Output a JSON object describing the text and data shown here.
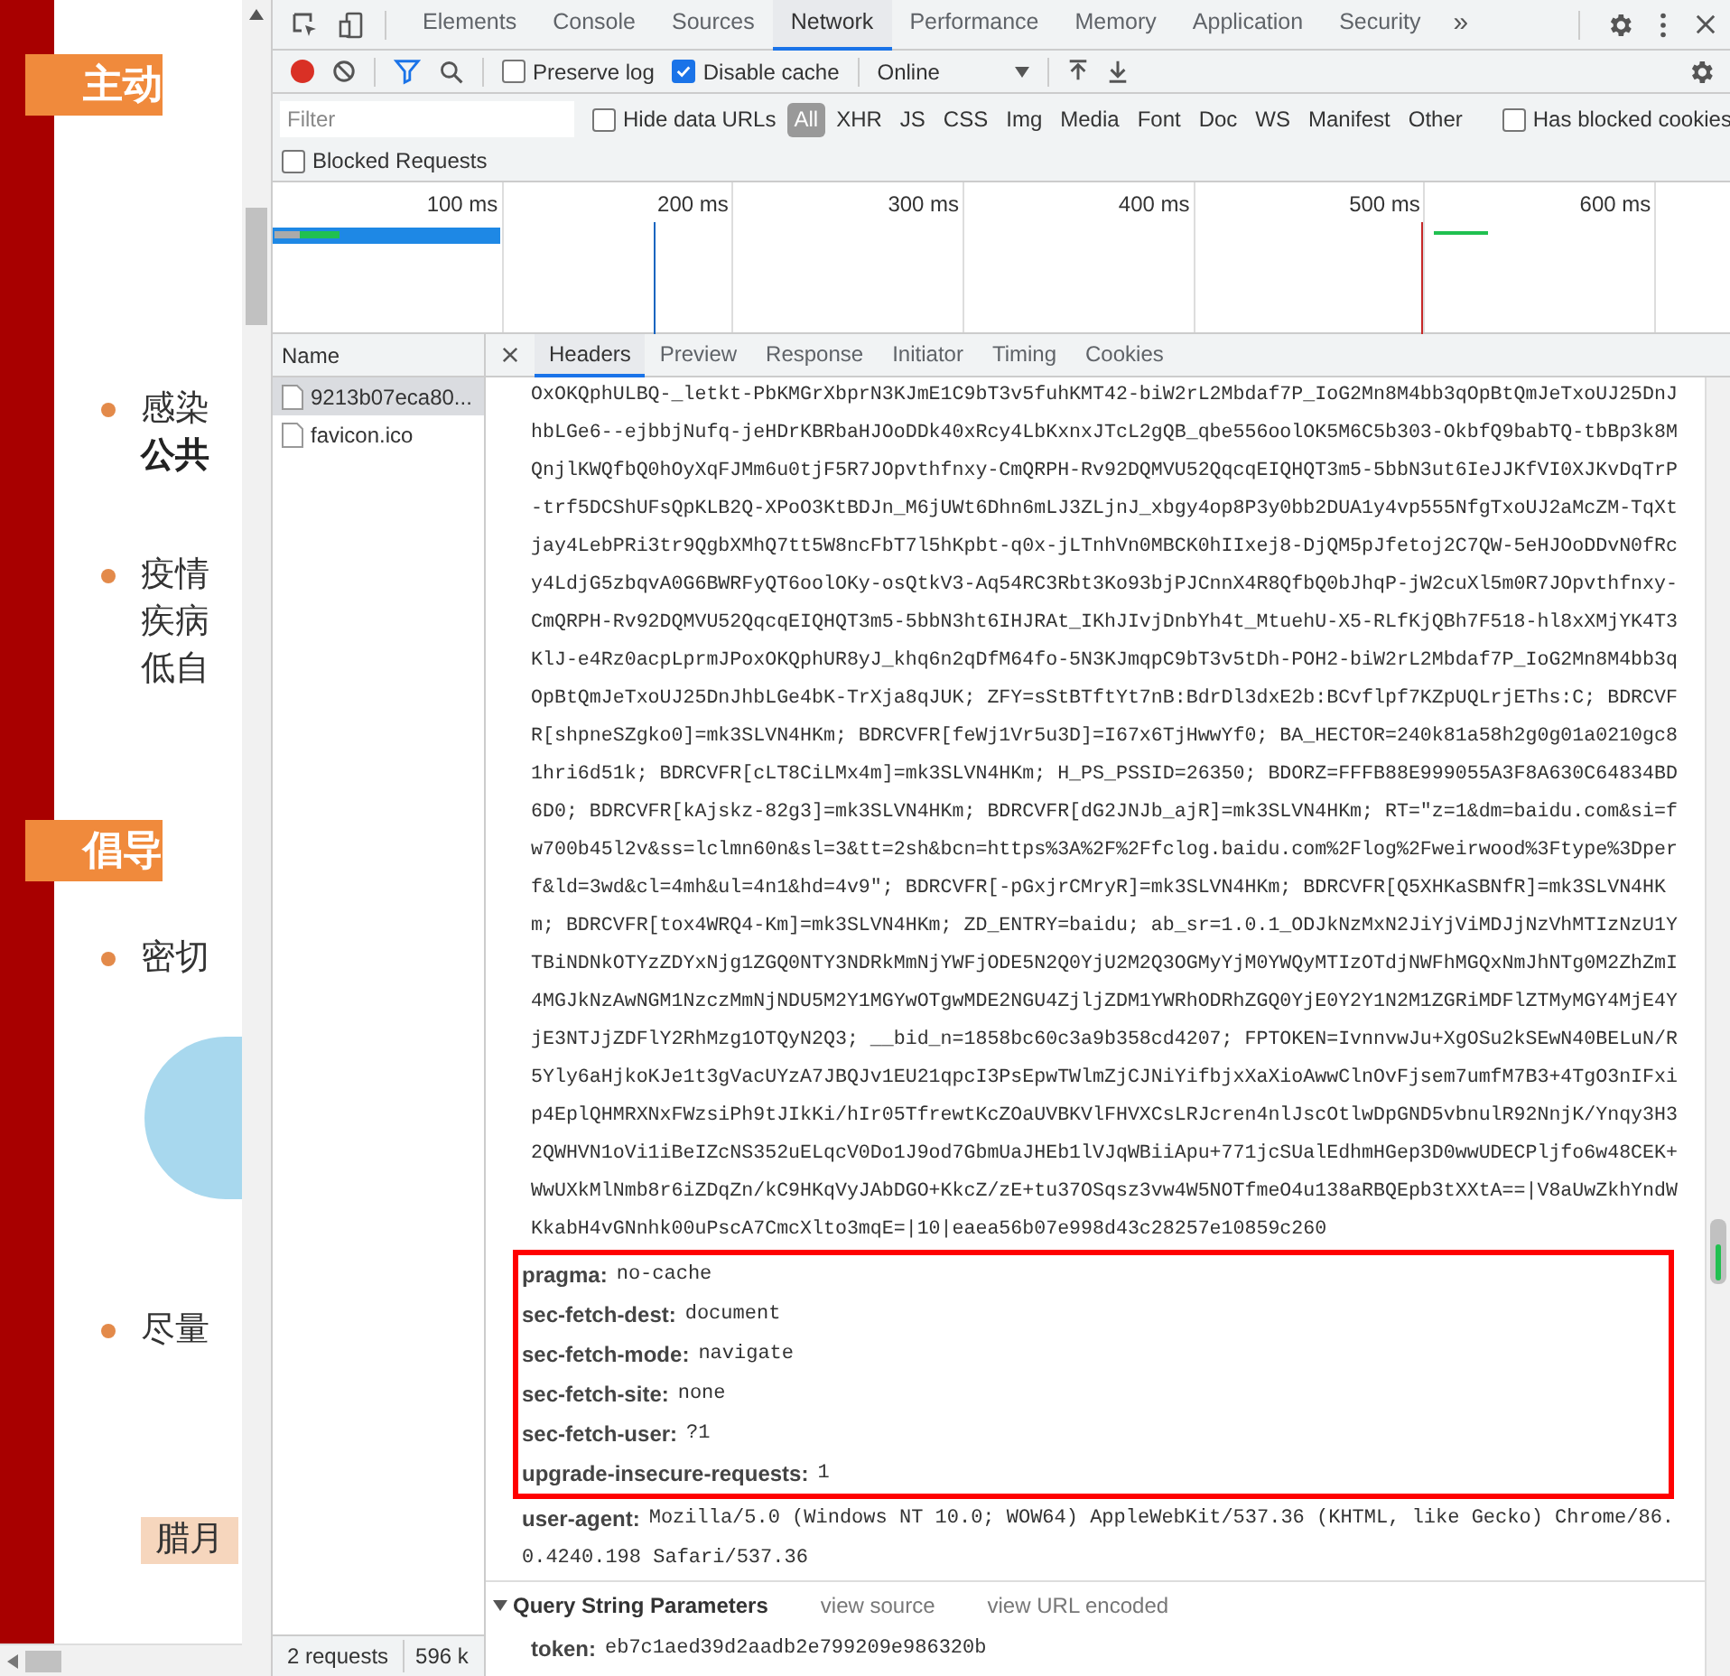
{
  "page": {
    "texts": [
      {
        "kind": "banner",
        "text": "主动"
      },
      {
        "kind": "bullet",
        "text": "感染"
      },
      {
        "kind": "bold",
        "text": "公共"
      },
      {
        "kind": "bullet",
        "text": "疫情"
      },
      {
        "kind": "plain",
        "text": "疾病"
      },
      {
        "kind": "plain",
        "text": "低自"
      },
      {
        "kind": "banner",
        "text": "倡导"
      },
      {
        "kind": "bullet",
        "text": "密切"
      },
      {
        "kind": "image"
      },
      {
        "kind": "bullet",
        "text": "尽量"
      },
      {
        "kind": "label",
        "text": "腊月"
      }
    ]
  },
  "panel_tabs": [
    {
      "label": "Elements",
      "selected": false
    },
    {
      "label": "Console",
      "selected": false
    },
    {
      "label": "Sources",
      "selected": false
    },
    {
      "label": "Network",
      "selected": true
    },
    {
      "label": "Performance",
      "selected": false
    },
    {
      "label": "Memory",
      "selected": false
    },
    {
      "label": "Application",
      "selected": false
    },
    {
      "label": "Security",
      "selected": false
    }
  ],
  "more_tabs": "»",
  "toolbar": {
    "preserve_log": {
      "label": "Preserve log",
      "checked": false
    },
    "disable_cache": {
      "label": "Disable cache",
      "checked": true
    },
    "throttling": "Online"
  },
  "filter": {
    "placeholder": "Filter",
    "hide_data_urls": {
      "label": "Hide data URLs",
      "checked": false
    },
    "types": [
      {
        "label": "All",
        "selected": true
      },
      {
        "label": "XHR",
        "selected": false
      },
      {
        "label": "JS",
        "selected": false
      },
      {
        "label": "CSS",
        "selected": false
      },
      {
        "label": "Img",
        "selected": false
      },
      {
        "label": "Media",
        "selected": false
      },
      {
        "label": "Font",
        "selected": false
      },
      {
        "label": "Doc",
        "selected": false
      },
      {
        "label": "WS",
        "selected": false
      },
      {
        "label": "Manifest",
        "selected": false
      },
      {
        "label": "Other",
        "selected": false
      }
    ],
    "has_blocked_cookies": {
      "label": "Has blocked cookies",
      "checked": false
    },
    "blocked_requests": {
      "label": "Blocked Requests",
      "checked": false
    }
  },
  "timeline": {
    "ticks": [
      "100 ms",
      "200 ms",
      "300 ms",
      "400 ms",
      "500 ms",
      "600 ms"
    ]
  },
  "requests": {
    "column": "Name",
    "items": [
      {
        "name": "9213b07eca80...",
        "selected": true
      },
      {
        "name": "favicon.ico",
        "selected": false
      }
    ],
    "status": [
      "2 requests",
      "596 k"
    ]
  },
  "detail_tabs": [
    {
      "label": "Headers",
      "selected": true
    },
    {
      "label": "Preview",
      "selected": false
    },
    {
      "label": "Response",
      "selected": false
    },
    {
      "label": "Initiator",
      "selected": false
    },
    {
      "label": "Timing",
      "selected": false
    },
    {
      "label": "Cookies",
      "selected": false
    }
  ],
  "cookie_lines": [
    "OxOKQphULBQ-_letkt-PbKMGrXbprN3KJmE1C9bT3v5fuhKMT42-biW2rL2Mbdaf7P_IoG2Mn8M4bb3qOpBtQmJeTxoUJ25DnJ",
    "hbLGe6--ejbbjNufq-jeHDrKBRbaHJOoDDk40xRcy4LbKxnxJTcL2gQB_qbe556oolOK5M6C5b303-OkbfQ9babTQ-tbBp3k8M",
    "QnjlKWQfbQ0hOyXqFJMm6u0tjF5R7JOpvthfnxy-CmQRPH-Rv92DQMVU52QqcqEIQHQT3m5-5bbN3ut6IeJJKfVI0XJKvDqTrP",
    "-trf5DCShUFsQpKLB2Q-XPoO3KtBDJn_M6jUWt6Dhn6mLJ3ZLjnJ_xbgy4op8P3y0bb2DUA1y4vp555NfgTxoUJ2aMcZM-TqXt",
    "jay4LebPRi3tr9QgbXMhQ7tt5W8ncFbT7l5hKpbt-q0x-jLTnhVn0MBCK0hIIxej8-DjQM5pJfetoj2C7QW-5eHJOoDDvN0fRc",
    "y4LdjG5zbqvA0G6BWRFyQT6oolOKy-osQtkV3-Aq54RC3Rbt3Ko93bjPJCnnX4R8QfbQ0bJhqP-jW2cuXl5m0R7JOpvthfnxy-",
    "CmQRPH-Rv92DQMVU52QqcqEIQHQT3m5-5bbN3ht6IHJRAt_IKhJIvjDnbYh4t_MtuehU-X5-RLfKjQBh7F518-hl8xXMjYK4T3",
    "KlJ-e4Rz0acpLprmJPoxOKQphUR8yJ_khq6n2qDfM64fo-5N3KJmqpC9bT3v5tDh-POH2-biW2rL2Mbdaf7P_IoG2Mn8M4bb3q",
    "OpBtQmJeTxoUJ25DnJhbLGe4bK-TrXja8qJUK; ZFY=sStBTftYt7nB:BdrDl3dxE2b:BCvflpf7KZpUQLrjEThs:C; BDRCVF",
    "R[shpneSZgko0]=mk3SLVN4HKm; BDRCVFR[feWj1Vr5u3D]=I67x6TjHwwYf0; BA_HECTOR=240k81a58h2g0g01a0210gc8",
    "1hri6d51k; BDRCVFR[cLT8CiLMx4m]=mk3SLVN4HKm; H_PS_PSSID=26350; BDORZ=FFFB88E999055A3F8A630C64834BD",
    "6D0; BDRCVFR[kAjskz-82g3]=mk3SLVN4HKm; BDRCVFR[dG2JNJb_ajR]=mk3SLVN4HKm; RT=\"z=1&dm=baidu.com&si=f",
    "w700b45l2v&ss=lclmn60n&sl=3&tt=2sh&bcn=https%3A%2F%2Ffclog.baidu.com%2Flog%2Fweirwood%3Ftype%3Dper",
    "f&ld=3wd&cl=4mh&ul=4n1&hd=4v9\"; BDRCVFR[-pGxjrCMryR]=mk3SLVN4HKm; BDRCVFR[Q5XHKaSBNfR]=mk3SLVN4HK",
    "m; BDRCVFR[tox4WRQ4-Km]=mk3SLVN4HKm; ZD_ENTRY=baidu; ab_sr=1.0.1_ODJkNzMxN2JiYjViMDJjNzVhMTIzNzU1Y",
    "TBiNDNkOTYzZDYxNjg1ZGQ0NTY3NDRkMmNjYWFjODE5N2Q0YjU2M2Q3OGMyYjM0YWQyMTIzOTdjNWFhMGQxNmJhNTg0M2ZhZmI",
    "4MGJkNzAwNGM1NzczMmNjNDU5M2Y1MGYwOTgwMDE2NGU4ZjljZDM1YWRhODRhZGQ0YjE0Y2Y1N2M1ZGRiMDFlZTMyMGY4MjE4Y",
    "jE3NTJjZDFlY2RhMzg1OTQyN2Q3; __bid_n=1858bc60c3a9b358cd4207; FPTOKEN=IvnnvwJu+XgOSu2kSEwN40BELuN/R",
    "5Yly6aHjkoKJe1t3gVacUYzA7JBQJv1EU21qpcI3PsEpwTWlmZjCJNiYifbjxXaXioAwwClnOvFjsem7umfM7B3+4TgO3nIFxi",
    "p4EplQHMRXNxFWzsiPh9tJIkKi/hIr05TfrewtKcZOaUVBKVlFHVXCsLRJcren4nlJscOtlwDpGND5vbnulR92NnjK/Ynqy3H3",
    "2QWHVN1oVi1iBeIZcNS352uELqcV0Do1J9od7GbmUaJHEb1lVJqWBiiApu+771jcSUalEdhmHGep3D0wwUDECPljfo6w48CEK+",
    "WwUXkMlNmb8r6iZDqZn/kC9HKqVyJAbDGO+KkcZ/zE+tu37OSqsz3vw4W5NOTfmeO4u138aRBQEpb3tXXtA==|V8aUwZkhYndW",
    "KkabH4vGNnhk00uPscA7CmcXlto3mqE=|10|eaea56b07e998d43c28257e10859c260"
  ],
  "highlighted_headers": [
    {
      "name": "pragma:",
      "value": "no-cache"
    },
    {
      "name": "sec-fetch-dest:",
      "value": "document"
    },
    {
      "name": "sec-fetch-mode:",
      "value": "navigate"
    },
    {
      "name": "sec-fetch-site:",
      "value": "none"
    },
    {
      "name": "sec-fetch-user:",
      "value": "?1"
    },
    {
      "name": "upgrade-insecure-requests:",
      "value": "1"
    }
  ],
  "other_headers": [
    {
      "name": "user-agent:",
      "value": "Mozilla/5.0 (Windows NT 10.0; WOW64) AppleWebKit/537.36 (KHTML, like Gecko) Chrome/86.",
      "continuation": "0.4240.198 Safari/537.36"
    }
  ],
  "query_section": {
    "title": "Query String Parameters",
    "expanded": true,
    "links": [
      "view source",
      "view URL encoded"
    ],
    "params": [
      {
        "name": "token:",
        "value": "eb7c1aed39d2aadb2e799209e986320b"
      }
    ]
  }
}
